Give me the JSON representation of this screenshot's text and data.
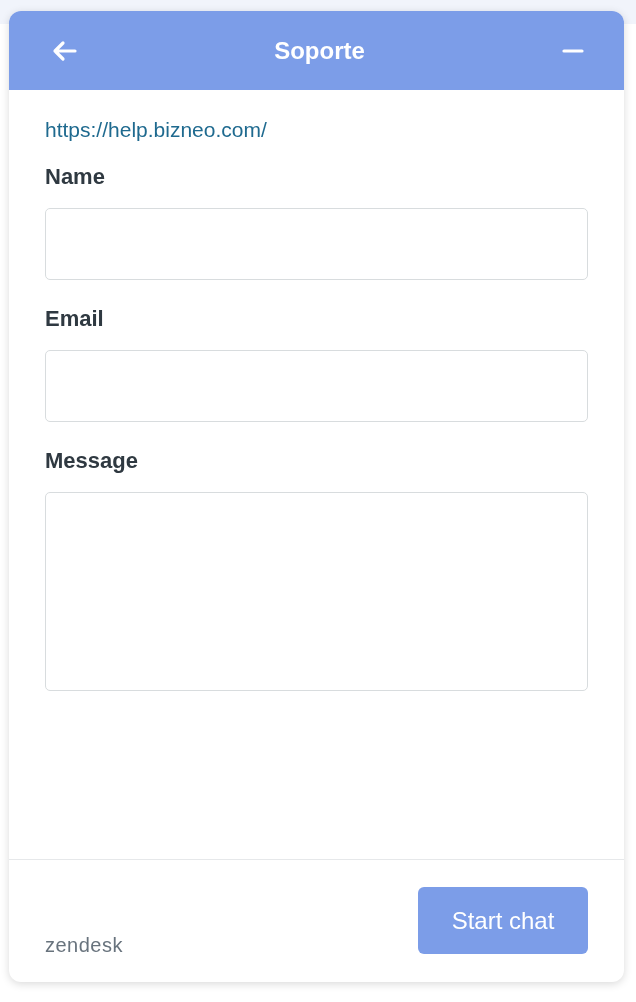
{
  "header": {
    "title": "Soporte"
  },
  "link": "https://help.bizneo.com/",
  "fields": [
    {
      "label": "Name",
      "kind": "input"
    },
    {
      "label": "Email",
      "kind": "input"
    },
    {
      "label": "Message",
      "kind": "textarea"
    }
  ],
  "footer": {
    "brand": "zendesk",
    "button": "Start chat"
  }
}
